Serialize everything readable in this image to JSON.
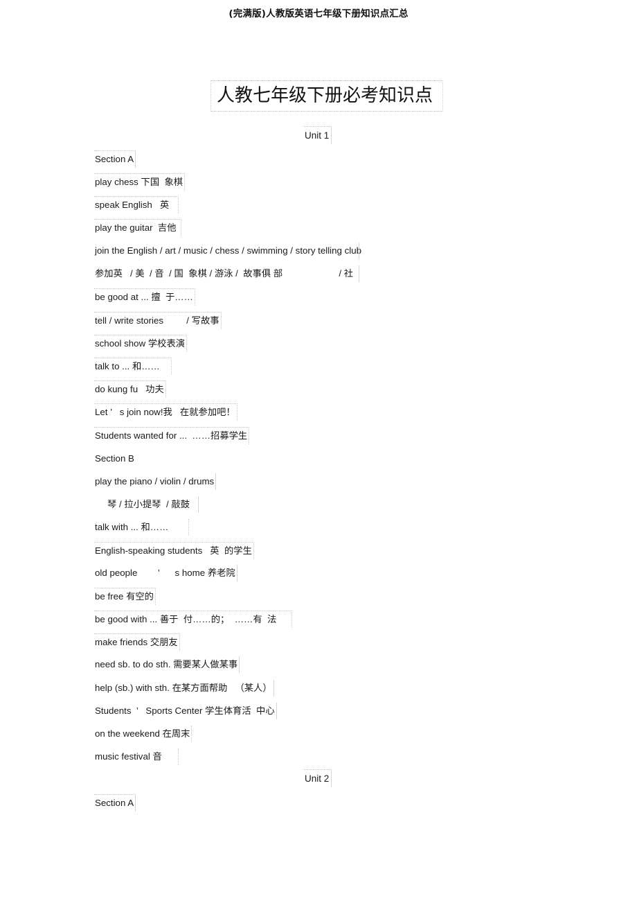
{
  "document": {
    "running_header": "(完满版)人教版英语七年级下册知识点汇总",
    "title": "人教七年级下册必考知识点"
  },
  "units": [
    {
      "heading": "Unit 1",
      "sections": [
        {
          "label": "Section A",
          "entries": [
            "play chess 下国  象棋",
            "speak English   英",
            "play the guitar  吉他",
            "join the English / art / music / chess / swimming / story telling club",
            "参加英   / 美  / 音  / 国  象棋 / 游泳 /  故事俱 部                      / 社",
            "be good at ... 擅  于……",
            "tell / write stories         / 写故事",
            "school show 学校表演",
            "talk to ... 和……",
            "do kung fu   功夫",
            "Let ’   s join now!我   在就参加吧！",
            "Students wanted for ...  ……招募学生"
          ]
        },
        {
          "label": "Section B",
          "entries": [
            "play the piano / violin / drums",
            "琴 / 拉小提琴  / 敲鼓",
            "talk with ... 和……",
            "English-speaking students   英  的学生",
            "old people        ’      s home 养老院",
            "be free 有空的",
            "be good with ... 善于  付……的；  ……有  法",
            "make friends 交朋友",
            "need sb. to do sth. 需要某人做某事",
            "help (sb.) with sth. 在某方面帮助   （某人）",
            "Students  ’   Sports Center 学生体育活  中心",
            "on the weekend 在周末",
            "music festival 音"
          ]
        }
      ]
    },
    {
      "heading": "Unit 2",
      "sections": [
        {
          "label": "Section A",
          "entries": []
        }
      ]
    }
  ]
}
